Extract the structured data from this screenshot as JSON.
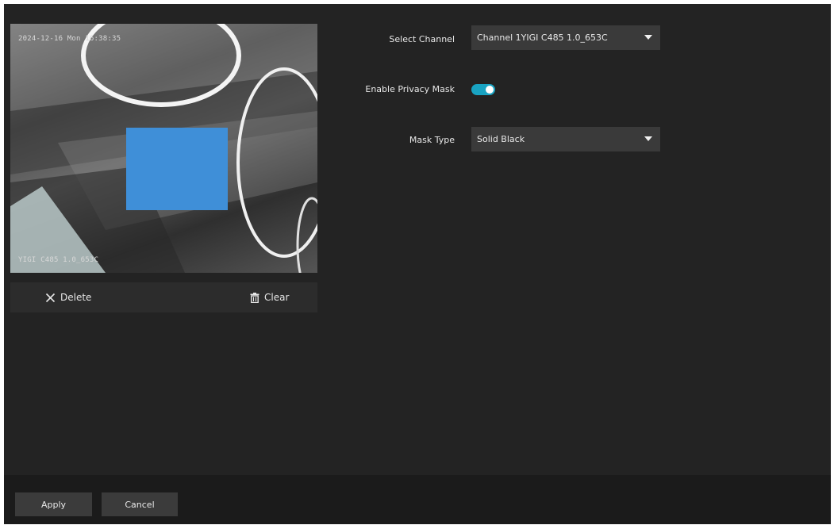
{
  "preview": {
    "osd_timestamp": "2024-12-16 Mon 16:38:35",
    "osd_channel_name": "YIGI C485 1.0_653C",
    "mask_color": "#3f8fd8"
  },
  "toolbar": {
    "delete_label": "Delete",
    "delete_icon": "close-icon",
    "clear_label": "Clear",
    "clear_icon": "trash-icon"
  },
  "form": {
    "channel_label": "Select Channel",
    "channel_value": "Channel 1YIGI C485 1.0_653C",
    "privacy_label": "Enable Privacy Mask",
    "privacy_enabled": true,
    "mask_type_label": "Mask Type",
    "mask_type_value": "Solid Black"
  },
  "footer": {
    "apply_label": "Apply",
    "cancel_label": "Cancel"
  },
  "colors": {
    "accent": "#19a3c2",
    "panel": "#232323",
    "control": "#3a3a3a"
  }
}
